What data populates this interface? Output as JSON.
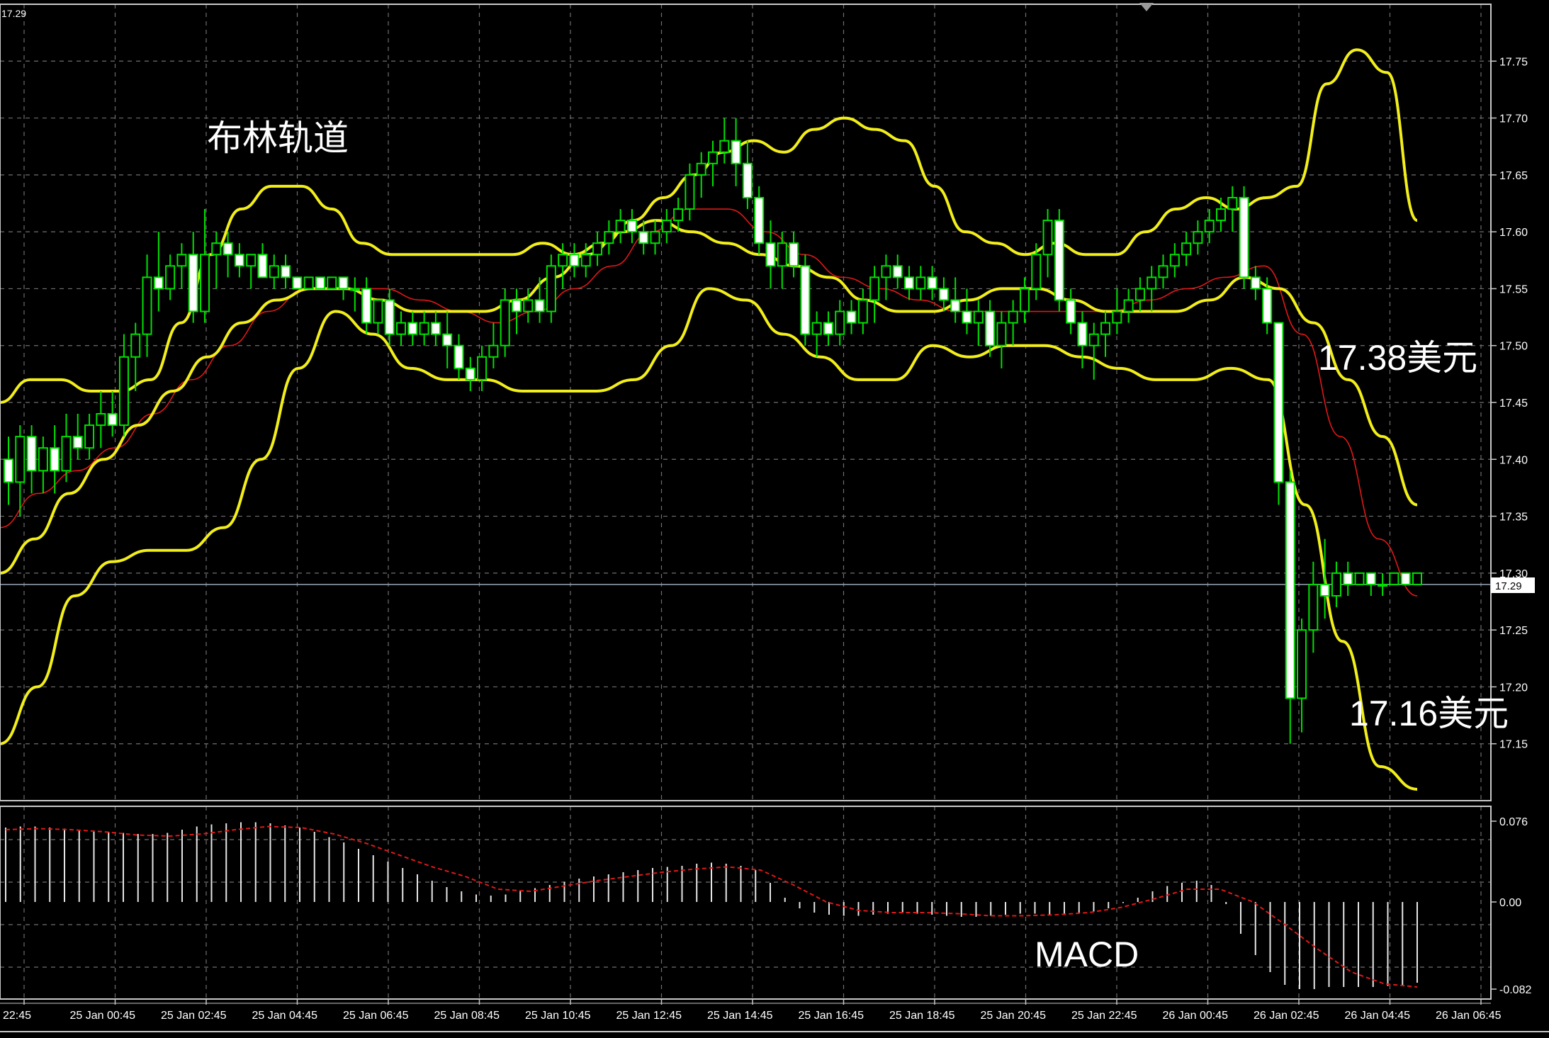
{
  "chart_data": {
    "type": "candlestick",
    "symbol_price_label": "17.29",
    "current_price": 17.29,
    "annotations": {
      "bollinger_label": "布林轨道",
      "upper_target_label": "17.38美元",
      "lower_target_label": "17.16美元",
      "macd_label": "MACD"
    },
    "price_axis": {
      "min": 17.1,
      "max": 17.8,
      "ticks": [
        17.75,
        17.7,
        17.65,
        17.6,
        17.55,
        17.5,
        17.45,
        17.4,
        17.35,
        17.3,
        17.25,
        17.2,
        17.15
      ],
      "tick_labels": [
        "17.75",
        "17.70",
        "17.65",
        "17.60",
        "17.55",
        "17.50",
        "17.45",
        "17.40",
        "17.35",
        "17.30",
        "17.25",
        "17.20",
        "17.15"
      ]
    },
    "macd_axis": {
      "min": -0.09,
      "max": 0.082,
      "tick_labels": [
        "0.076",
        "0.00",
        "-0.082"
      ],
      "ticks": [
        0.076,
        0.0,
        -0.082
      ]
    },
    "time_labels": [
      "22:45",
      "25 Jan 00:45",
      "25 Jan 02:45",
      "25 Jan 04:45",
      "25 Jan 06:45",
      "25 Jan 08:45",
      "25 Jan 10:45",
      "25 Jan 12:45",
      "25 Jan 14:45",
      "25 Jan 16:45",
      "25 Jan 18:45",
      "25 Jan 20:45",
      "25 Jan 22:45",
      "26 Jan 00:45",
      "26 Jan 02:45",
      "26 Jan 04:45",
      "26 Jan 06:45"
    ],
    "candles": [
      [
        17.4,
        17.42,
        17.36,
        17.38
      ],
      [
        17.38,
        17.43,
        17.35,
        17.42
      ],
      [
        17.42,
        17.43,
        17.37,
        17.39
      ],
      [
        17.39,
        17.42,
        17.37,
        17.41
      ],
      [
        17.41,
        17.43,
        17.37,
        17.39
      ],
      [
        17.39,
        17.44,
        17.38,
        17.42
      ],
      [
        17.42,
        17.44,
        17.4,
        17.41
      ],
      [
        17.41,
        17.44,
        17.4,
        17.43
      ],
      [
        17.43,
        17.46,
        17.41,
        17.44
      ],
      [
        17.44,
        17.46,
        17.42,
        17.43
      ],
      [
        17.43,
        17.51,
        17.42,
        17.49
      ],
      [
        17.49,
        17.52,
        17.46,
        17.51
      ],
      [
        17.51,
        17.58,
        17.49,
        17.56
      ],
      [
        17.56,
        17.6,
        17.53,
        17.55
      ],
      [
        17.55,
        17.58,
        17.54,
        17.57
      ],
      [
        17.57,
        17.59,
        17.55,
        17.58
      ],
      [
        17.58,
        17.6,
        17.52,
        17.53
      ],
      [
        17.53,
        17.62,
        17.52,
        17.58
      ],
      [
        17.58,
        17.6,
        17.55,
        17.59
      ],
      [
        17.59,
        17.6,
        17.56,
        17.58
      ],
      [
        17.58,
        17.59,
        17.56,
        17.57
      ],
      [
        17.57,
        17.58,
        17.55,
        17.58
      ],
      [
        17.58,
        17.59,
        17.56,
        17.56
      ],
      [
        17.56,
        17.58,
        17.55,
        17.57
      ],
      [
        17.57,
        17.58,
        17.55,
        17.56
      ],
      [
        17.56,
        17.56,
        17.55,
        17.55
      ],
      [
        17.55,
        17.56,
        17.55,
        17.56
      ],
      [
        17.56,
        17.56,
        17.55,
        17.55
      ],
      [
        17.55,
        17.56,
        17.55,
        17.56
      ],
      [
        17.56,
        17.56,
        17.54,
        17.55
      ],
      [
        17.55,
        17.56,
        17.53,
        17.55
      ],
      [
        17.55,
        17.56,
        17.51,
        17.52
      ],
      [
        17.52,
        17.54,
        17.51,
        17.54
      ],
      [
        17.54,
        17.55,
        17.5,
        17.51
      ],
      [
        17.51,
        17.53,
        17.5,
        17.52
      ],
      [
        17.52,
        17.53,
        17.5,
        17.51
      ],
      [
        17.51,
        17.53,
        17.5,
        17.52
      ],
      [
        17.52,
        17.53,
        17.5,
        17.51
      ],
      [
        17.51,
        17.53,
        17.48,
        17.5
      ],
      [
        17.5,
        17.51,
        17.47,
        17.48
      ],
      [
        17.48,
        17.49,
        17.46,
        17.47
      ],
      [
        17.47,
        17.5,
        17.46,
        17.49
      ],
      [
        17.49,
        17.52,
        17.48,
        17.5
      ],
      [
        17.5,
        17.55,
        17.49,
        17.54
      ],
      [
        17.54,
        17.55,
        17.51,
        17.53
      ],
      [
        17.53,
        17.55,
        17.52,
        17.54
      ],
      [
        17.54,
        17.56,
        17.52,
        17.53
      ],
      [
        17.53,
        17.58,
        17.52,
        17.57
      ],
      [
        17.57,
        17.59,
        17.55,
        17.58
      ],
      [
        17.58,
        17.59,
        17.56,
        17.57
      ],
      [
        17.57,
        17.59,
        17.56,
        17.58
      ],
      [
        17.58,
        17.6,
        17.57,
        17.59
      ],
      [
        17.59,
        17.61,
        17.58,
        17.6
      ],
      [
        17.6,
        17.62,
        17.59,
        17.61
      ],
      [
        17.61,
        17.62,
        17.59,
        17.6
      ],
      [
        17.6,
        17.61,
        17.58,
        17.59
      ],
      [
        17.59,
        17.61,
        17.58,
        17.6
      ],
      [
        17.6,
        17.62,
        17.59,
        17.61
      ],
      [
        17.61,
        17.63,
        17.6,
        17.62
      ],
      [
        17.62,
        17.66,
        17.61,
        17.65
      ],
      [
        17.65,
        17.67,
        17.63,
        17.66
      ],
      [
        17.66,
        17.68,
        17.64,
        17.67
      ],
      [
        17.67,
        17.7,
        17.66,
        17.68
      ],
      [
        17.68,
        17.7,
        17.64,
        17.66
      ],
      [
        17.66,
        17.68,
        17.62,
        17.63
      ],
      [
        17.63,
        17.64,
        17.58,
        17.59
      ],
      [
        17.59,
        17.61,
        17.55,
        17.57
      ],
      [
        17.57,
        17.6,
        17.55,
        17.59
      ],
      [
        17.59,
        17.6,
        17.56,
        17.57
      ],
      [
        17.57,
        17.58,
        17.5,
        17.51
      ],
      [
        17.51,
        17.53,
        17.49,
        17.52
      ],
      [
        17.52,
        17.53,
        17.5,
        17.51
      ],
      [
        17.51,
        17.54,
        17.5,
        17.53
      ],
      [
        17.53,
        17.54,
        17.51,
        17.52
      ],
      [
        17.52,
        17.55,
        17.51,
        17.54
      ],
      [
        17.54,
        17.57,
        17.52,
        17.56
      ],
      [
        17.56,
        17.58,
        17.54,
        17.57
      ],
      [
        17.57,
        17.58,
        17.55,
        17.56
      ],
      [
        17.56,
        17.57,
        17.54,
        17.55
      ],
      [
        17.55,
        17.57,
        17.54,
        17.56
      ],
      [
        17.56,
        17.57,
        17.54,
        17.55
      ],
      [
        17.55,
        17.56,
        17.53,
        17.54
      ],
      [
        17.54,
        17.56,
        17.52,
        17.53
      ],
      [
        17.53,
        17.55,
        17.51,
        17.52
      ],
      [
        17.52,
        17.54,
        17.5,
        17.53
      ],
      [
        17.53,
        17.54,
        17.49,
        17.5
      ],
      [
        17.5,
        17.53,
        17.48,
        17.52
      ],
      [
        17.52,
        17.54,
        17.5,
        17.53
      ],
      [
        17.53,
        17.56,
        17.52,
        17.55
      ],
      [
        17.55,
        17.59,
        17.54,
        17.58
      ],
      [
        17.58,
        17.62,
        17.56,
        17.61
      ],
      [
        17.61,
        17.62,
        17.53,
        17.54
      ],
      [
        17.54,
        17.55,
        17.51,
        17.52
      ],
      [
        17.52,
        17.53,
        17.48,
        17.5
      ],
      [
        17.5,
        17.52,
        17.47,
        17.51
      ],
      [
        17.51,
        17.53,
        17.49,
        17.52
      ],
      [
        17.52,
        17.55,
        17.51,
        17.53
      ],
      [
        17.53,
        17.55,
        17.52,
        17.54
      ],
      [
        17.54,
        17.56,
        17.53,
        17.55
      ],
      [
        17.55,
        17.57,
        17.53,
        17.56
      ],
      [
        17.56,
        17.58,
        17.55,
        17.57
      ],
      [
        17.57,
        17.59,
        17.56,
        17.58
      ],
      [
        17.58,
        17.6,
        17.57,
        17.59
      ],
      [
        17.59,
        17.61,
        17.58,
        17.6
      ],
      [
        17.6,
        17.62,
        17.59,
        17.61
      ],
      [
        17.61,
        17.63,
        17.6,
        17.62
      ],
      [
        17.62,
        17.64,
        17.6,
        17.63
      ],
      [
        17.63,
        17.64,
        17.55,
        17.56
      ],
      [
        17.56,
        17.57,
        17.54,
        17.55
      ],
      [
        17.55,
        17.56,
        17.51,
        17.52
      ],
      [
        17.52,
        17.52,
        17.36,
        17.38
      ],
      [
        17.38,
        17.39,
        17.15,
        17.19
      ],
      [
        17.19,
        17.26,
        17.16,
        17.25
      ],
      [
        17.25,
        17.31,
        17.23,
        17.29
      ],
      [
        17.29,
        17.33,
        17.26,
        17.28
      ],
      [
        17.28,
        17.31,
        17.27,
        17.3
      ],
      [
        17.3,
        17.31,
        17.28,
        17.29
      ],
      [
        17.29,
        17.3,
        17.29,
        17.3
      ],
      [
        17.3,
        17.3,
        17.28,
        17.29
      ],
      [
        17.29,
        17.3,
        17.28,
        17.29
      ],
      [
        17.29,
        17.3,
        17.29,
        17.3
      ],
      [
        17.3,
        17.3,
        17.29,
        17.29
      ],
      [
        17.29,
        17.3,
        17.29,
        17.3
      ]
    ],
    "bollinger_upper": [
      17.45,
      17.47,
      17.47,
      17.46,
      17.46,
      17.47,
      17.52,
      17.58,
      17.62,
      17.64,
      17.64,
      17.62,
      17.59,
      17.58,
      17.58,
      17.58,
      17.58,
      17.58,
      17.59,
      17.58,
      17.59,
      17.61,
      17.63,
      17.65,
      17.67,
      17.68,
      17.67,
      17.69,
      17.7,
      17.69,
      17.68,
      17.64,
      17.6,
      17.59,
      17.58,
      17.59,
      17.58,
      17.58,
      17.6,
      17.62,
      17.63,
      17.62,
      17.63,
      17.64,
      17.73,
      17.76,
      17.74,
      17.61
    ],
    "bollinger_middle": [
      17.3,
      17.33,
      17.37,
      17.4,
      17.43,
      17.46,
      17.49,
      17.52,
      17.54,
      17.55,
      17.55,
      17.54,
      17.53,
      17.53,
      17.53,
      17.54,
      17.56,
      17.58,
      17.6,
      17.61,
      17.6,
      17.59,
      17.58,
      17.57,
      17.56,
      17.54,
      17.53,
      17.53,
      17.54,
      17.55,
      17.55,
      17.54,
      17.53,
      17.53,
      17.53,
      17.54,
      17.56,
      17.55,
      17.52,
      17.47,
      17.42,
      17.36
    ],
    "bollinger_lower": [
      17.15,
      17.2,
      17.28,
      17.31,
      17.32,
      17.32,
      17.34,
      17.4,
      17.48,
      17.53,
      17.51,
      17.48,
      17.47,
      17.47,
      17.46,
      17.46,
      17.46,
      17.47,
      17.5,
      17.55,
      17.54,
      17.51,
      17.49,
      17.47,
      17.47,
      17.5,
      17.49,
      17.5,
      17.5,
      17.49,
      17.48,
      17.47,
      17.47,
      17.48,
      17.47,
      17.36,
      17.24,
      17.13,
      17.11
    ],
    "moving_average": [
      17.34,
      17.37,
      17.39,
      17.41,
      17.44,
      17.47,
      17.5,
      17.53,
      17.55,
      17.55,
      17.55,
      17.54,
      17.53,
      17.52,
      17.53,
      17.55,
      17.57,
      17.6,
      17.62,
      17.62,
      17.6,
      17.58,
      17.56,
      17.55,
      17.54,
      17.53,
      17.53,
      17.53,
      17.53,
      17.53,
      17.54,
      17.55,
      17.56,
      17.57,
      17.51,
      17.42,
      17.33,
      17.28
    ],
    "macd_histogram": [
      0.07,
      0.071,
      0.071,
      0.07,
      0.069,
      0.068,
      0.066,
      0.066,
      0.065,
      0.064,
      0.064,
      0.065,
      0.068,
      0.071,
      0.073,
      0.074,
      0.075,
      0.075,
      0.074,
      0.072,
      0.07,
      0.066,
      0.061,
      0.056,
      0.05,
      0.044,
      0.038,
      0.032,
      0.026,
      0.02,
      0.014,
      0.01,
      0.007,
      0.006,
      0.007,
      0.01,
      0.013,
      0.016,
      0.019,
      0.022,
      0.024,
      0.026,
      0.028,
      0.03,
      0.032,
      0.033,
      0.034,
      0.036,
      0.037,
      0.036,
      0.034,
      0.03,
      0.018,
      0.004,
      -0.006,
      -0.01,
      -0.012,
      -0.013,
      -0.013,
      -0.012,
      -0.011,
      -0.01,
      -0.011,
      -0.012,
      -0.013,
      -0.014,
      -0.014,
      -0.013,
      -0.012,
      -0.011,
      -0.011,
      -0.012,
      -0.012,
      -0.011,
      -0.009,
      -0.006,
      -0.001,
      0.004,
      0.01,
      0.015,
      0.018,
      0.02,
      0.016,
      -0.002,
      -0.03,
      -0.05,
      -0.066,
      -0.078,
      -0.082,
      -0.082,
      -0.08,
      -0.08,
      -0.08,
      -0.08,
      -0.079,
      -0.078,
      -0.076
    ],
    "macd_signal": [
      0.068,
      0.069,
      0.068,
      0.066,
      0.063,
      0.062,
      0.064,
      0.068,
      0.071,
      0.07,
      0.064,
      0.055,
      0.044,
      0.033,
      0.024,
      0.012,
      0.01,
      0.015,
      0.02,
      0.024,
      0.028,
      0.031,
      0.033,
      0.03,
      0.016,
      0.0,
      -0.008,
      -0.01,
      -0.01,
      -0.011,
      -0.013,
      -0.013,
      -0.012,
      -0.01,
      -0.005,
      0.003,
      0.012,
      0.012,
      0.0,
      -0.022,
      -0.045,
      -0.066,
      -0.077,
      -0.08
    ]
  }
}
